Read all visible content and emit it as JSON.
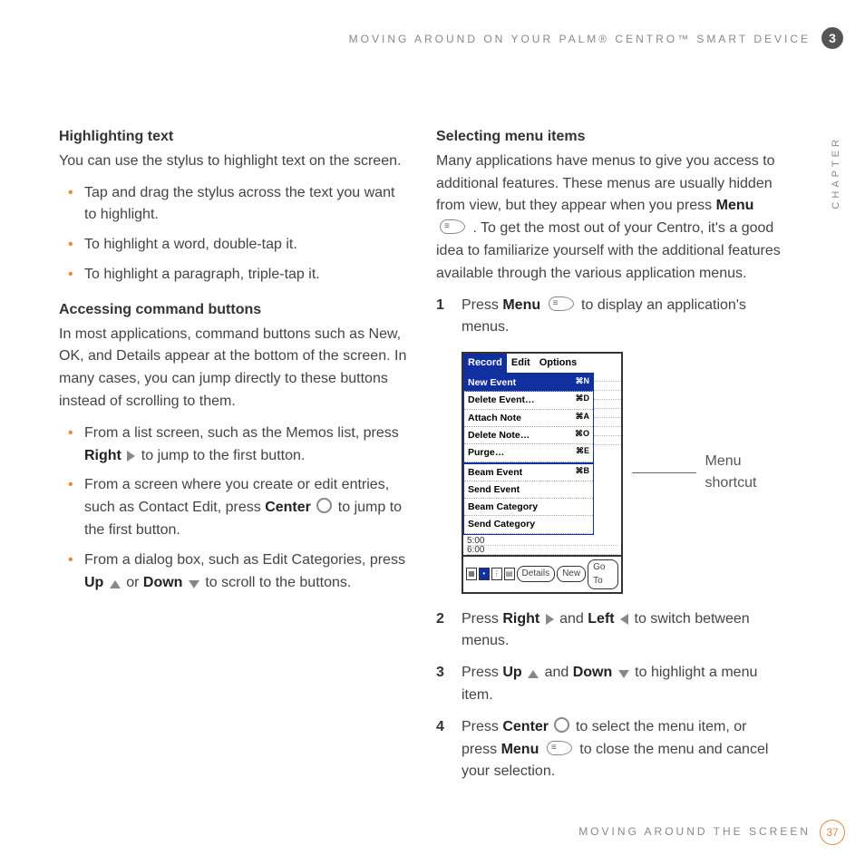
{
  "header": {
    "line": "MOVING AROUND ON YOUR PALM® CENTRO™ SMART DEVICE",
    "chapter_number": "3",
    "chapter_label": "CHAPTER"
  },
  "footer": {
    "text": "MOVING AROUND THE SCREEN",
    "page": "37"
  },
  "left": {
    "h1": "Highlighting text",
    "p1": "You can use the stylus to highlight text on the screen.",
    "b1_a": "Tap and drag the stylus across the text you want to highlight.",
    "b1_b": "To highlight a word, double-tap it.",
    "b1_c": "To highlight a paragraph, triple-tap it.",
    "h2": "Accessing command buttons",
    "p2": "In most applications, command buttons such as New, OK, and Details appear at the bottom of the screen. In many cases, you can jump directly to these buttons instead of scrolling to them.",
    "b2_a_pre": "From a list screen, such as the Memos list, press ",
    "b2_a_key": "Right",
    "b2_a_post": " to jump to the first button.",
    "b2_b_pre": "From a screen where you create or edit entries, such as Contact Edit, press ",
    "b2_b_key": "Center",
    "b2_b_post": " to jump to the first button.",
    "b2_c_pre": "From a dialog box, such as Edit Categories, press ",
    "b2_c_key1": "Up",
    "b2_c_mid": " or ",
    "b2_c_key2": "Down",
    "b2_c_post": " to scroll to the buttons."
  },
  "right": {
    "h1": "Selecting menu items",
    "p1_a": "Many applications have menus to give you access to additional features. These menus are usually hidden from view, but they appear when you press ",
    "p1_key": "Menu",
    "p1_b": ". To get the most out of your Centro, it's a good idea to familiarize yourself with the additional features available through the various application menus.",
    "step1_a": "Press ",
    "step1_key": "Menu",
    "step1_b": " to display an application's menus.",
    "callout": "Menu shortcut",
    "step2_a": "Press ",
    "step2_k1": "Right",
    "step2_mid": " and ",
    "step2_k2": "Left",
    "step2_b": " to switch between menus.",
    "step3_a": "Press ",
    "step3_k1": "Up",
    "step3_mid": " and ",
    "step3_k2": "Down",
    "step3_b": " to highlight a menu item.",
    "step4_a": "Press ",
    "step4_k1": "Center",
    "step4_mid": " to select the menu item, or press ",
    "step4_k2": "Menu",
    "step4_b": " to close the menu and cancel your selection."
  },
  "pda": {
    "tabs": {
      "record": "Record",
      "edit": "Edit",
      "options": "Options"
    },
    "items": [
      {
        "label": "New Event",
        "sc": "N",
        "sel": true
      },
      {
        "label": "Delete Event…",
        "sc": "D"
      },
      {
        "label": "Attach Note",
        "sc": "A"
      },
      {
        "label": "Delete Note…",
        "sc": "O"
      },
      {
        "label": "Purge…",
        "sc": "E"
      }
    ],
    "items2": [
      {
        "label": "Beam Event",
        "sc": "B"
      },
      {
        "label": "Send Event"
      },
      {
        "label": "Beam Category"
      },
      {
        "label": "Send Category"
      }
    ],
    "times": [
      "5:00",
      "6:00"
    ],
    "buttons": {
      "details": "Details",
      "new": "New",
      "goto": "Go To"
    }
  }
}
